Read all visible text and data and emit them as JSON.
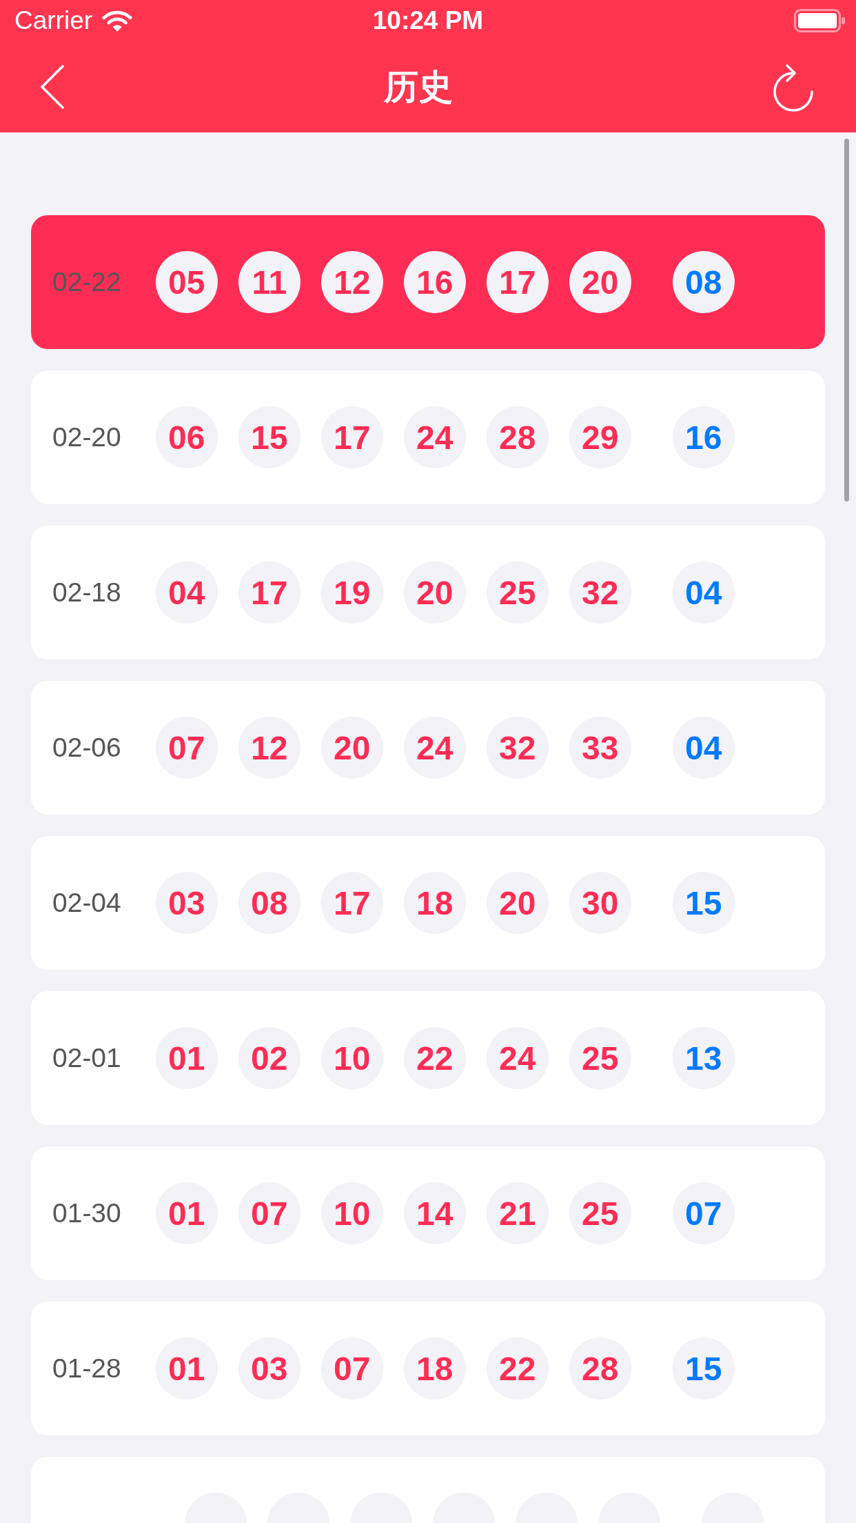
{
  "status_bar": {
    "carrier": "Carrier",
    "time": "10:24 PM"
  },
  "nav_bar": {
    "title": "历史"
  },
  "draws": [
    {
      "date": "02-22",
      "selected": true,
      "red_balls": [
        "05",
        "11",
        "12",
        "16",
        "17",
        "20"
      ],
      "blue_ball": "08"
    },
    {
      "date": "02-20",
      "selected": false,
      "red_balls": [
        "06",
        "15",
        "17",
        "24",
        "28",
        "29"
      ],
      "blue_ball": "16"
    },
    {
      "date": "02-18",
      "selected": false,
      "red_balls": [
        "04",
        "17",
        "19",
        "20",
        "25",
        "32"
      ],
      "blue_ball": "04"
    },
    {
      "date": "02-06",
      "selected": false,
      "red_balls": [
        "07",
        "12",
        "20",
        "24",
        "32",
        "33"
      ],
      "blue_ball": "04"
    },
    {
      "date": "02-04",
      "selected": false,
      "red_balls": [
        "03",
        "08",
        "17",
        "18",
        "20",
        "30"
      ],
      "blue_ball": "15"
    },
    {
      "date": "02-01",
      "selected": false,
      "red_balls": [
        "01",
        "02",
        "10",
        "22",
        "24",
        "25"
      ],
      "blue_ball": "13"
    },
    {
      "date": "01-30",
      "selected": false,
      "red_balls": [
        "01",
        "07",
        "10",
        "14",
        "21",
        "25"
      ],
      "blue_ball": "07"
    },
    {
      "date": "01-28",
      "selected": false,
      "red_balls": [
        "01",
        "03",
        "07",
        "18",
        "22",
        "28"
      ],
      "blue_ball": "15"
    }
  ],
  "partial_draw": {
    "selected": false
  }
}
